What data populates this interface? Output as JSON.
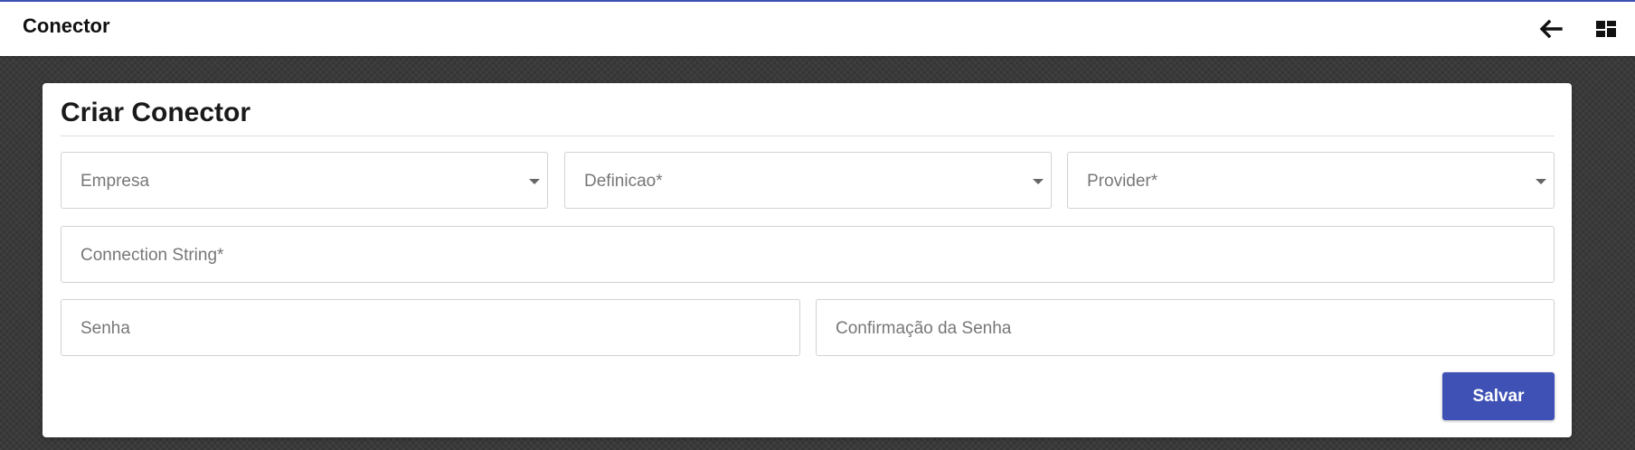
{
  "header": {
    "title": "Conector",
    "back_icon": "arrow-left-icon",
    "view_icon": "dashboard-layout-icon"
  },
  "form": {
    "title": "Criar Conector",
    "empresa_placeholder": "Empresa",
    "definicao_placeholder": "Definicao*",
    "provider_placeholder": "Provider*",
    "connection_string_placeholder": "Connection String*",
    "senha_placeholder": "Senha",
    "confirmacao_senha_placeholder": "Confirmação da Senha",
    "save_label": "Salvar"
  },
  "colors": {
    "accent": "#3f51b5",
    "background": "#3a3a3a",
    "card": "#ffffff"
  }
}
